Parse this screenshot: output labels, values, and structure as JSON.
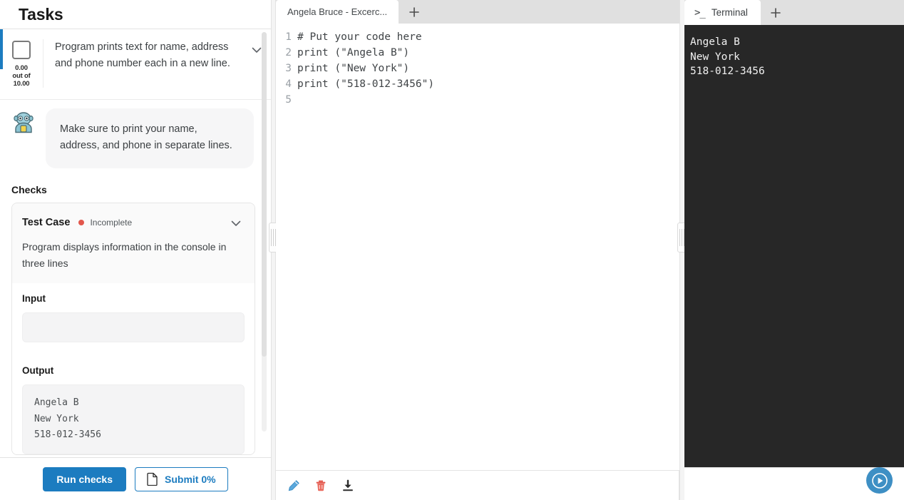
{
  "tasks_panel": {
    "title": "Tasks",
    "task": {
      "checkbox_checked": false,
      "score_current": "0.00",
      "score_middle": "out of",
      "score_max": "10.00",
      "description": "Program prints text for name, address and phone number each in a new line.",
      "expand_icon": "chevron-down-icon",
      "accent_color": "#1c7cc0"
    },
    "hint": {
      "avatar_icon": "robot-avatar-icon",
      "text": "Make sure to print your name, address, and phone in separate lines."
    },
    "checks_label": "Checks",
    "check": {
      "name": "Test Case",
      "status": "Incomplete",
      "status_color": "#e2574c",
      "description": "Program displays information in the console in three lines",
      "expand_icon": "chevron-down-icon",
      "input_label": "Input",
      "input_value": "",
      "output_label": "Output",
      "output_value": "Angela B\nNew York\n518-012-3456"
    },
    "actions": {
      "run_checks_label": "Run checks",
      "submit_label": "Submit 0%",
      "submit_icon": "document-icon"
    }
  },
  "editor": {
    "tabs": [
      {
        "label": "Angela Bruce - Excerc...",
        "active": true
      }
    ],
    "add_tab_icon": "plus-icon",
    "code_lines": [
      {
        "number": "1",
        "text": "# Put your code here"
      },
      {
        "number": "2",
        "text": "print (\"Angela B\")"
      },
      {
        "number": "3",
        "text": "print (\"New York\")"
      },
      {
        "number": "4",
        "text": "print (\"518-012-3456\")"
      },
      {
        "number": "5",
        "text": ""
      }
    ],
    "toolbar": [
      {
        "icon": "edit-pencil-icon",
        "color": "#4a9fd8"
      },
      {
        "icon": "trash-delete-icon",
        "color": "#e2574c"
      },
      {
        "icon": "download-icon",
        "color": "#2b2b2b"
      }
    ]
  },
  "terminal": {
    "tab_label": "Terminal",
    "tab_prompt_icon": "terminal-prompt-icon",
    "add_tab_icon": "plus-icon",
    "output": "Angela B\nNew York\n518-012-3456",
    "run_button_icon": "play-icon",
    "run_button_color": "#3e8fc4"
  }
}
